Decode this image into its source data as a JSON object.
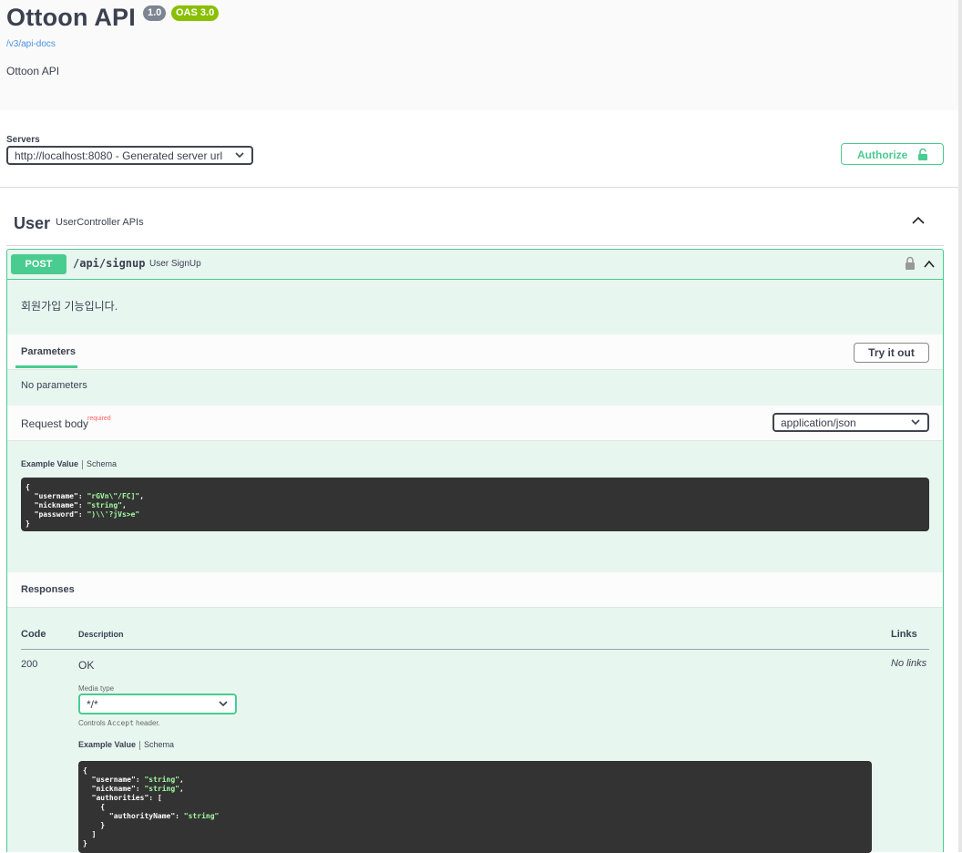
{
  "info": {
    "title": "Ottoon API",
    "version": "1.0",
    "oas": "OAS 3.0",
    "doc_link": "/v3/api-docs",
    "description": "Ottoon API"
  },
  "servers": {
    "label": "Servers",
    "selected": "http://localhost:8080 - Generated server url",
    "authorize_label": "Authorize"
  },
  "tag": {
    "name": "User",
    "description": "UserController APIs"
  },
  "operation": {
    "method": "POST",
    "path": "/api/signup",
    "summary": "User SignUp",
    "description": "회원가입 기능입니다.",
    "parameters_tab": "Parameters",
    "try_it_out": "Try it out",
    "no_parameters": "No parameters",
    "request_body": {
      "title": "Request body",
      "required": "required",
      "content_type": "application/json",
      "example_tab": "Example Value",
      "schema_tab": "Schema",
      "example_lines": [
        {
          "pre": "{",
          "key": "",
          "val": "",
          "post": ""
        },
        {
          "pre": "  ",
          "key": "\"username\"",
          "val": "\"rGVn\\\"/FC]\"",
          "post": ","
        },
        {
          "pre": "  ",
          "key": "\"nickname\"",
          "val": "\"string\"",
          "post": ","
        },
        {
          "pre": "  ",
          "key": "\"password\"",
          "val": "\")\\\\'?jVs>e\"",
          "post": ""
        },
        {
          "pre": "}",
          "key": "",
          "val": "",
          "post": ""
        }
      ]
    },
    "responses": {
      "title": "Responses",
      "col_code": "Code",
      "col_description": "Description",
      "col_links": "Links",
      "rows": [
        {
          "code": "200",
          "description": "OK",
          "links": "No links",
          "media_type_label": "Media type",
          "media_type": "*/*",
          "controls_note_a": "Controls ",
          "controls_note_mono": "Accept",
          "controls_note_b": " header.",
          "example_tab": "Example Value",
          "schema_tab": "Schema",
          "example_lines": [
            {
              "pre": "{",
              "key": "",
              "val": "",
              "post": ""
            },
            {
              "pre": "  ",
              "key": "\"username\"",
              "val": "\"string\"",
              "post": ","
            },
            {
              "pre": "  ",
              "key": "\"nickname\"",
              "val": "\"string\"",
              "post": ","
            },
            {
              "pre": "  ",
              "key": "\"authorities\"",
              "val": "",
              "post": ": ["
            },
            {
              "pre": "    {",
              "key": "",
              "val": "",
              "post": ""
            },
            {
              "pre": "      ",
              "key": "\"authorityName\"",
              "val": "\"string\"",
              "post": ""
            },
            {
              "pre": "    }",
              "key": "",
              "val": "",
              "post": ""
            },
            {
              "pre": "  ]",
              "key": "",
              "val": "",
              "post": ""
            },
            {
              "pre": "}",
              "key": "",
              "val": "",
              "post": ""
            }
          ]
        }
      ]
    }
  },
  "colors": {
    "post": "#49cc90",
    "op_bg": "#e8f6f0",
    "code_bg": "#333333",
    "string": "#a2fca2"
  },
  "icons": [
    "chevron-down-icon",
    "lock-icon",
    "chevron-up-icon",
    "unlock-icon"
  ]
}
